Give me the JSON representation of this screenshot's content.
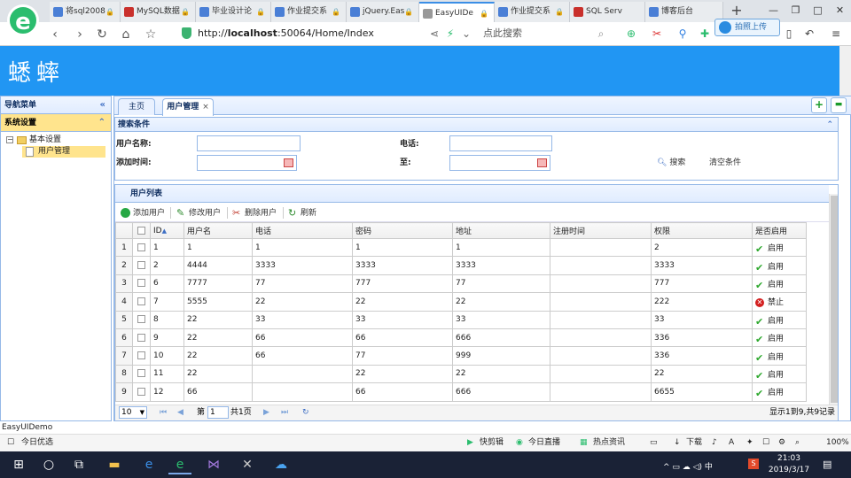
{
  "browser": {
    "tabs": [
      {
        "label": "将sql2008",
        "lock": "🔒",
        "active": false,
        "color": "#4a7fd6"
      },
      {
        "label": "MySQL数据",
        "lock": "🔒",
        "active": false,
        "color": "#c9302c"
      },
      {
        "label": "毕业设计论",
        "lock": "🔒",
        "active": false,
        "color": "#4a7fd6"
      },
      {
        "label": "作业提交系",
        "lock": "🔒",
        "active": false,
        "color": "#4a7fd6"
      },
      {
        "label": "jQuery.Eas",
        "lock": "🔒",
        "active": false,
        "color": "#4a7fd6"
      },
      {
        "label": "EasyUIDe",
        "lock": "🔒",
        "active": true,
        "color": "#999999"
      },
      {
        "label": "作业提交系",
        "lock": "🔒",
        "active": false,
        "color": "#4a7fd6"
      },
      {
        "label": "SQL Serv",
        "lock": "",
        "active": false,
        "color": "#c9302c"
      },
      {
        "label": "博客后台",
        "lock": "",
        "active": false,
        "color": "#4a7fd6"
      }
    ],
    "url_prefix": "http://",
    "url_host": "localhost",
    "url_rest": ":50064/Home/Index",
    "search_text": "点此搜索",
    "upload_popup": "拍照上传"
  },
  "app": {
    "title": "蟋蟀",
    "accent": "#2196f3"
  },
  "sidebar": {
    "header": "导航菜单",
    "section": "系统设置",
    "tree": {
      "parent": "基本设置",
      "child": "用户管理"
    }
  },
  "main_tabs": [
    {
      "label": "主页",
      "closable": false
    },
    {
      "label": "用户管理",
      "closable": true,
      "close": "×"
    }
  ],
  "search": {
    "title": "搜索条件",
    "username_label": "用户名称:",
    "phone_label": "电话:",
    "addtime_label": "添加时间:",
    "to_label": "至:",
    "search_btn": "搜索",
    "clear_btn": "清空条件"
  },
  "grid": {
    "title": "用户列表",
    "toolbar": {
      "add": "添加用户",
      "edit": "修改用户",
      "delete": "删除用户",
      "refresh": "刷新"
    },
    "columns": [
      "ID",
      "用户名",
      "电话",
      "密码",
      "地址",
      "注册时间",
      "权限",
      "是否启用"
    ],
    "sort_indicator": "▲",
    "rows": [
      {
        "n": "1",
        "id": "1",
        "name": "1",
        "phone": "1",
        "pwd": "1",
        "addr": "1",
        "reg": "",
        "perm": "2",
        "status": "启用",
        "enabled": true
      },
      {
        "n": "2",
        "id": "2",
        "name": "4444",
        "phone": "3333",
        "pwd": "3333",
        "addr": "3333",
        "reg": "",
        "perm": "3333",
        "status": "启用",
        "enabled": true
      },
      {
        "n": "3",
        "id": "6",
        "name": "7777",
        "phone": "77",
        "pwd": "777",
        "addr": "77",
        "reg": "",
        "perm": "777",
        "status": "启用",
        "enabled": true
      },
      {
        "n": "4",
        "id": "7",
        "name": "5555",
        "phone": "22",
        "pwd": "22",
        "addr": "22",
        "reg": "",
        "perm": "222",
        "status": "禁止",
        "enabled": false
      },
      {
        "n": "5",
        "id": "8",
        "name": "22",
        "phone": "33",
        "pwd": "33",
        "addr": "33",
        "reg": "",
        "perm": "33",
        "status": "启用",
        "enabled": true
      },
      {
        "n": "6",
        "id": "9",
        "name": "22",
        "phone": "66",
        "pwd": "66",
        "addr": "666",
        "reg": "",
        "perm": "336",
        "status": "启用",
        "enabled": true
      },
      {
        "n": "7",
        "id": "10",
        "name": "22",
        "phone": "66",
        "pwd": "77",
        "addr": "999",
        "reg": "",
        "perm": "336",
        "status": "启用",
        "enabled": true
      },
      {
        "n": "8",
        "id": "11",
        "name": "22",
        "phone": "",
        "pwd": "22",
        "addr": "22",
        "reg": "",
        "perm": "22",
        "status": "启用",
        "enabled": true
      },
      {
        "n": "9",
        "id": "12",
        "name": "66",
        "phone": "",
        "pwd": "66",
        "addr": "666",
        "reg": "",
        "perm": "6655",
        "status": "启用",
        "enabled": true
      }
    ]
  },
  "pager": {
    "page_size": "10",
    "page_prefix": "第",
    "page_num": "1",
    "page_suffix": "共1页",
    "summary": "显示1到9,共9记录"
  },
  "status": {
    "window_text": "EasyUIDemo",
    "left": "今日优选",
    "items": [
      "快剪辑",
      "今日直播",
      "热点资讯",
      "下载",
      "100%"
    ]
  },
  "taskbar": {
    "time": "21:03",
    "date": "2019/3/17"
  }
}
